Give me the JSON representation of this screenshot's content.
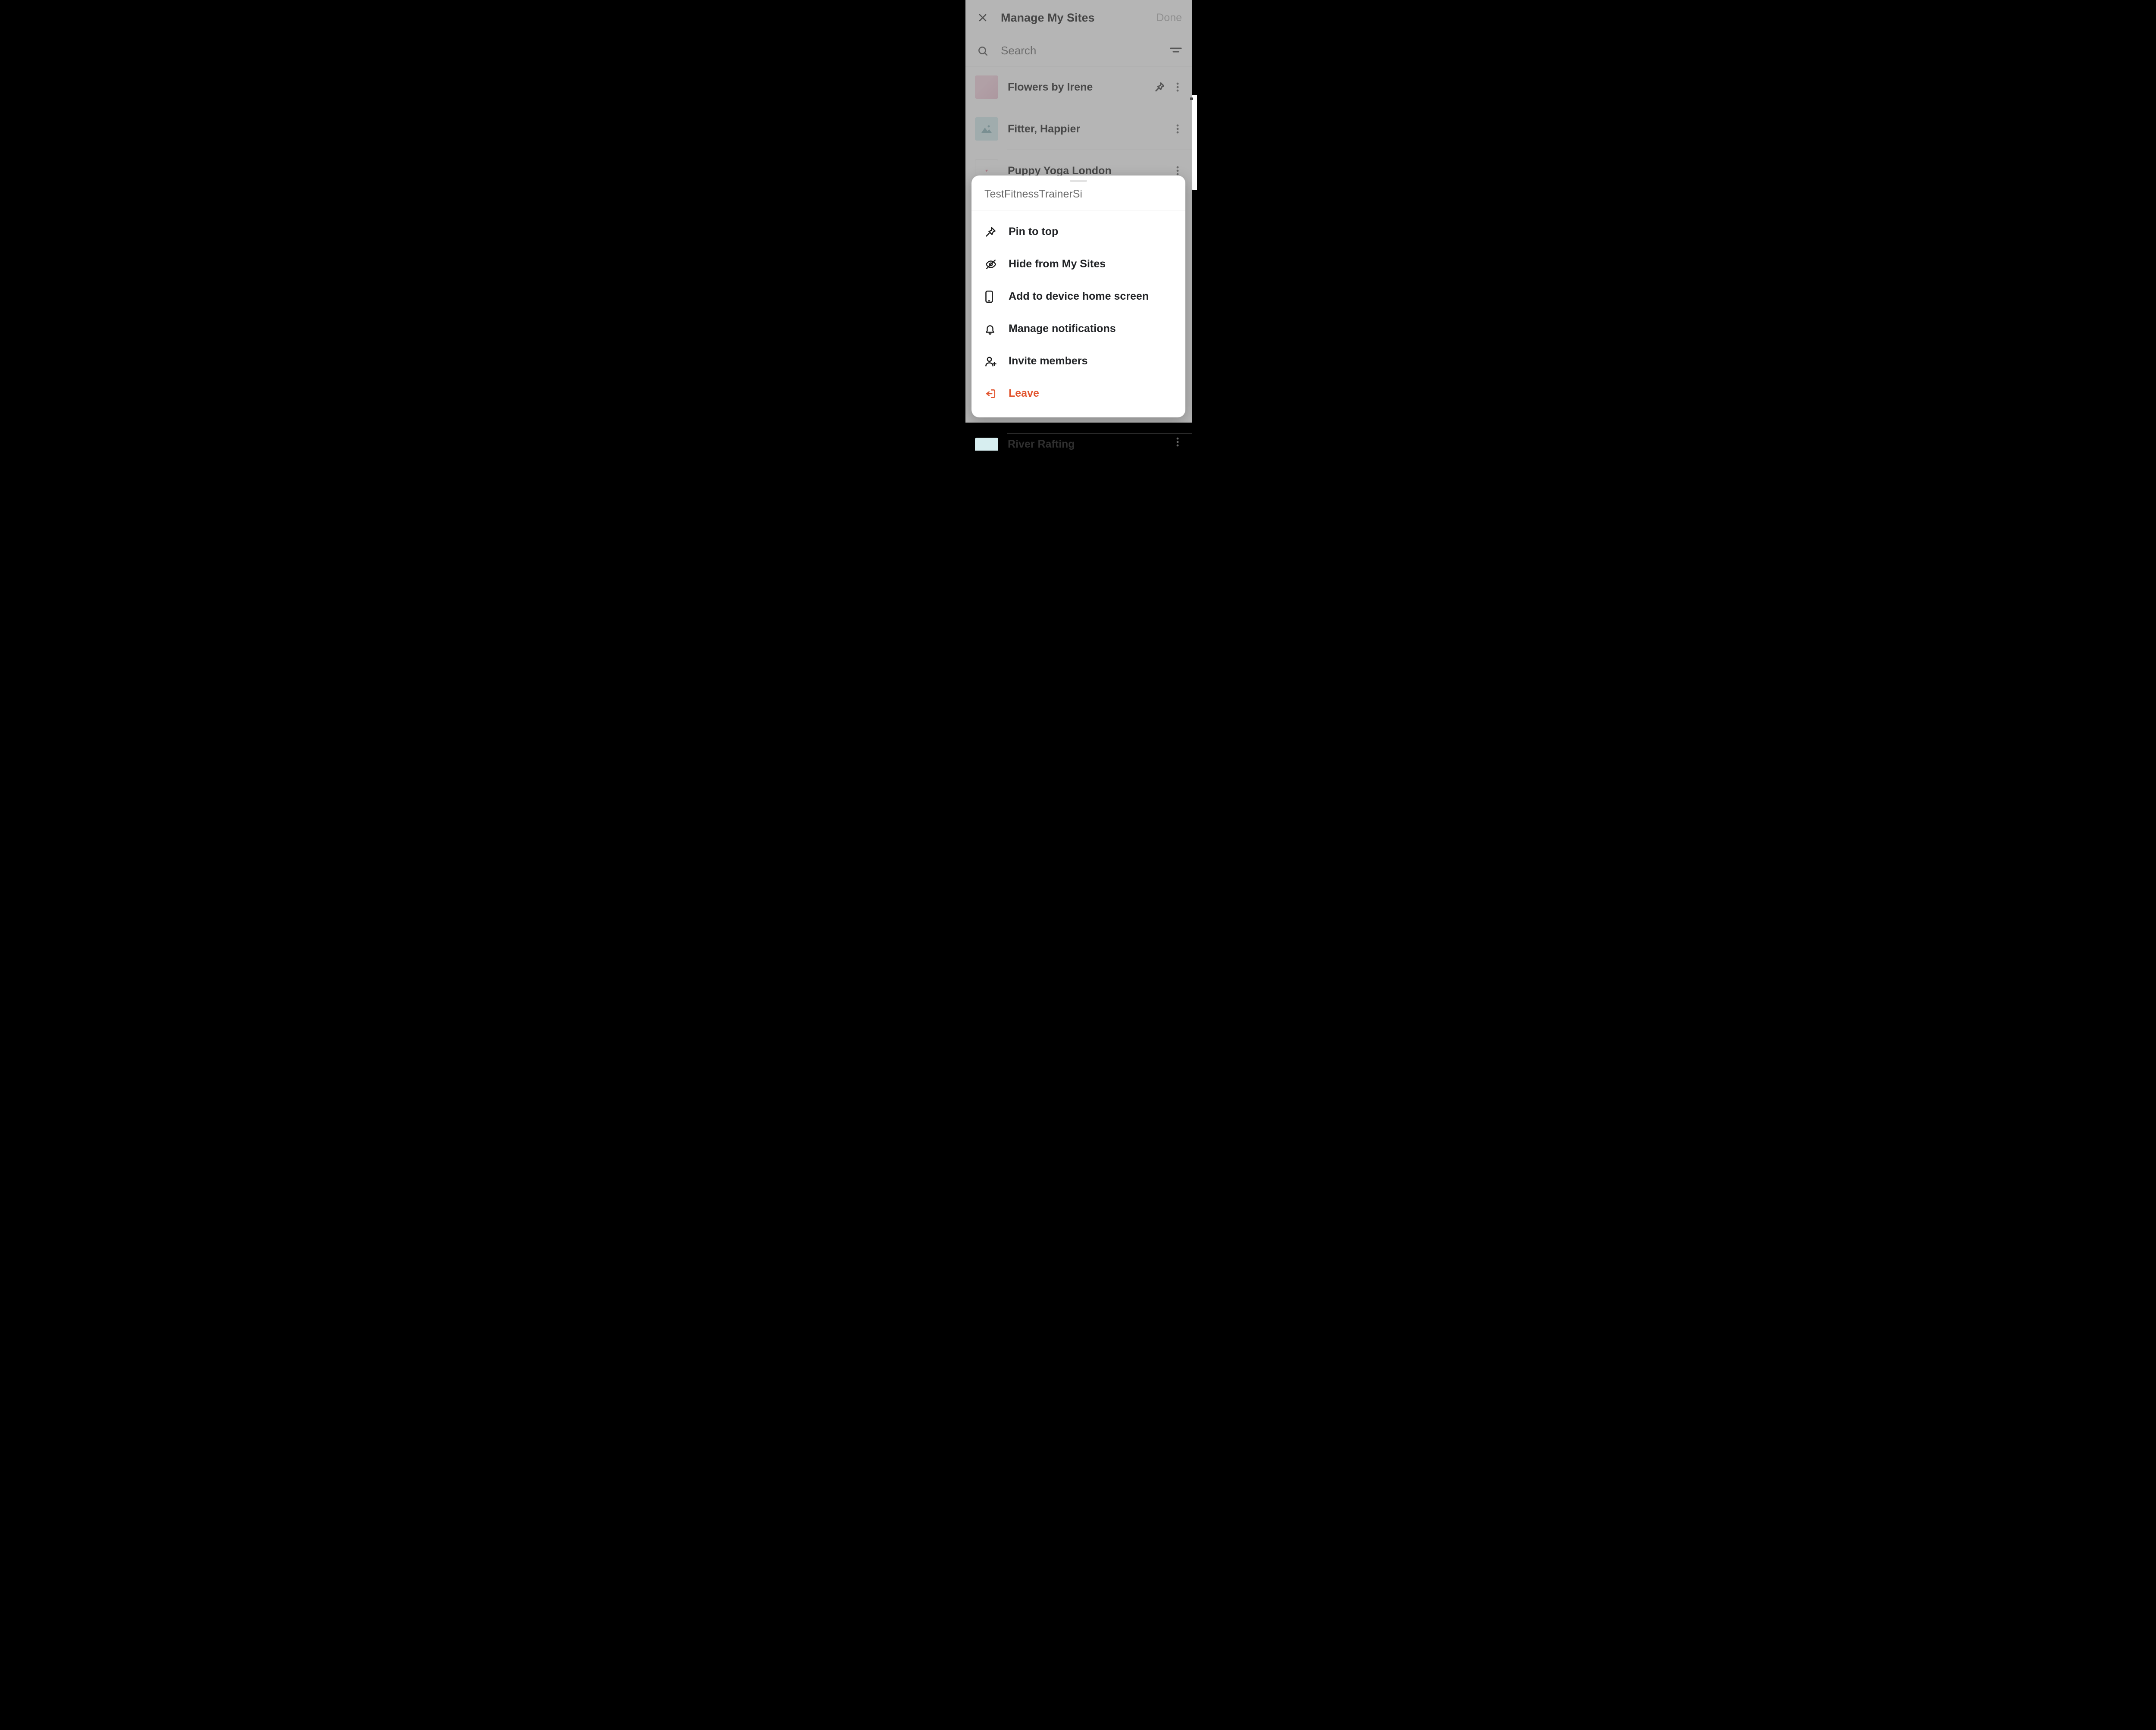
{
  "header": {
    "title": "Manage My Sites",
    "done": "Done"
  },
  "search": {
    "placeholder": "Search"
  },
  "sites": [
    {
      "name": "Flowers by Irene",
      "pinned": true,
      "thumb": "flowers"
    },
    {
      "name": "Fitter, Happier",
      "pinned": false,
      "thumb": "placeholder"
    },
    {
      "name": "Puppy Yoga London",
      "pinned": false,
      "thumb": "puppy"
    },
    {
      "name": "River Rafting",
      "pinned": false,
      "thumb": "placeholder"
    }
  ],
  "sheet": {
    "title": "TestFitnessTrainerSi",
    "items": [
      {
        "icon": "pin",
        "label": "Pin to top"
      },
      {
        "icon": "eye-off",
        "label": "Hide from My Sites"
      },
      {
        "icon": "phone",
        "label": "Add to device home screen"
      },
      {
        "icon": "bell",
        "label": "Manage notifications"
      },
      {
        "icon": "user-plus",
        "label": "Invite members"
      },
      {
        "icon": "leave",
        "label": "Leave",
        "danger": true
      }
    ]
  }
}
